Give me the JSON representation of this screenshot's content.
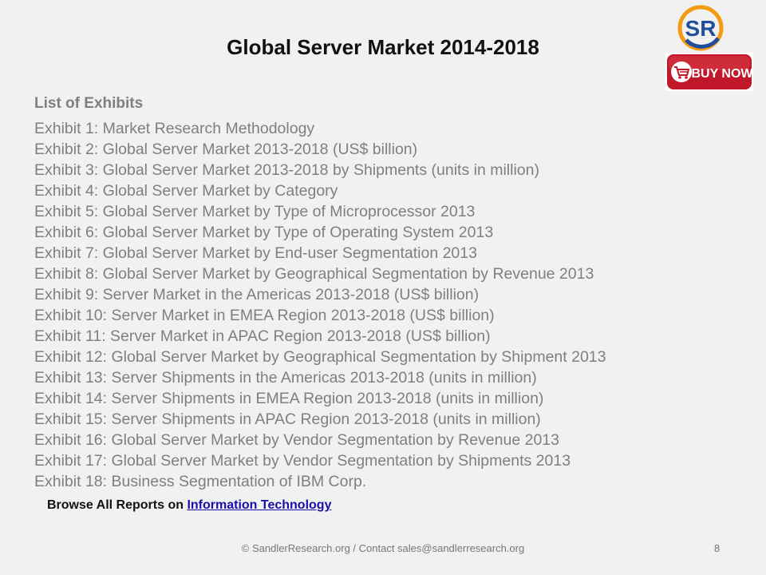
{
  "title": "Global Server Market 2014-2018",
  "logo": {
    "text": "SR",
    "colors": {
      "orange": "#f39c12",
      "blue": "#1f4e9c"
    }
  },
  "buy_now": {
    "label": "BUY NOW",
    "color": "#c0182a",
    "icon": "shopping-cart-icon"
  },
  "list_heading": "List of Exhibits",
  "exhibits": [
    "Exhibit 1: Market Research Methodology",
    "Exhibit 2: Global Server Market 2013-2018 (US$ billion)",
    "Exhibit 3: Global Server Market 2013-2018 by Shipments (units in million)",
    "Exhibit 4: Global Server Market by Category",
    "Exhibit 5: Global Server Market by Type of Microprocessor 2013",
    "Exhibit 6: Global Server Market by Type of Operating System 2013",
    "Exhibit 7: Global Server Market by End-user Segmentation 2013",
    "Exhibit 8: Global Server Market by Geographical Segmentation by Revenue 2013",
    "Exhibit 9: Server Market in the Americas 2013-2018 (US$ billion)",
    "Exhibit 10: Server Market in EMEA Region 2013-2018 (US$ billion)",
    "Exhibit 11: Server Market in APAC Region 2013-2018 (US$ billion)",
    "Exhibit 12: Global Server Market by Geographical Segmentation by Shipment 2013",
    "Exhibit 13: Server Shipments in the Americas 2013-2018 (units in million)",
    "Exhibit 14: Server Shipments in EMEA Region 2013-2018 (units in million)",
    "Exhibit 15: Server Shipments in APAC Region 2013-2018 (units in million)",
    "Exhibit 16: Global Server Market by Vendor Segmentation by Revenue 2013",
    "Exhibit 17: Global Server Market by Vendor Segmentation by Shipments 2013",
    "Exhibit 18: Business Segmentation of IBM Corp."
  ],
  "browse": {
    "prefix": "Browse All Reports on ",
    "link_text": "Information Technology"
  },
  "footer": "© SandlerResearch.org / Contact  sales@sandlerresearch.org",
  "page_number": "8"
}
